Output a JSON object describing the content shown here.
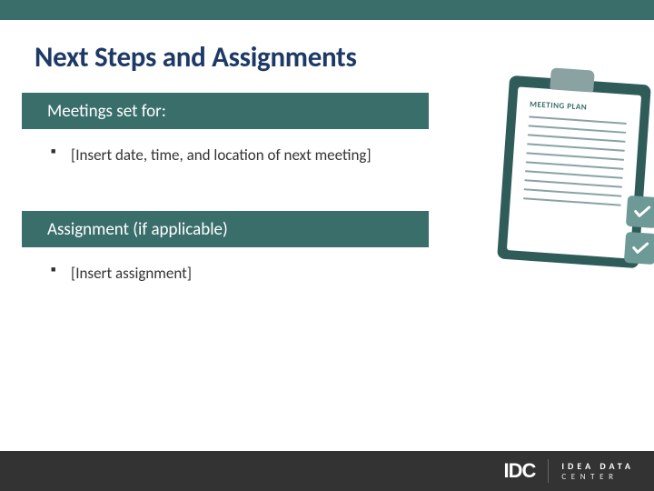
{
  "title": "Next Steps and Assignments",
  "sections": [
    {
      "heading": "Meetings set for:",
      "items": [
        "[Insert date, time, and location of next meeting]"
      ]
    },
    {
      "heading": "Assignment (if applicable)",
      "items": [
        "[Insert assignment]"
      ]
    }
  ],
  "clipboard": {
    "title": "MEETING PLAN"
  },
  "footer": {
    "logo_abbrev": "IDC",
    "logo_line1": "IDEA DATA",
    "logo_line2": "CENTER"
  },
  "colors": {
    "teal": "#3a6e6b",
    "dark": "#333333",
    "titleblue": "#1d3a66"
  }
}
